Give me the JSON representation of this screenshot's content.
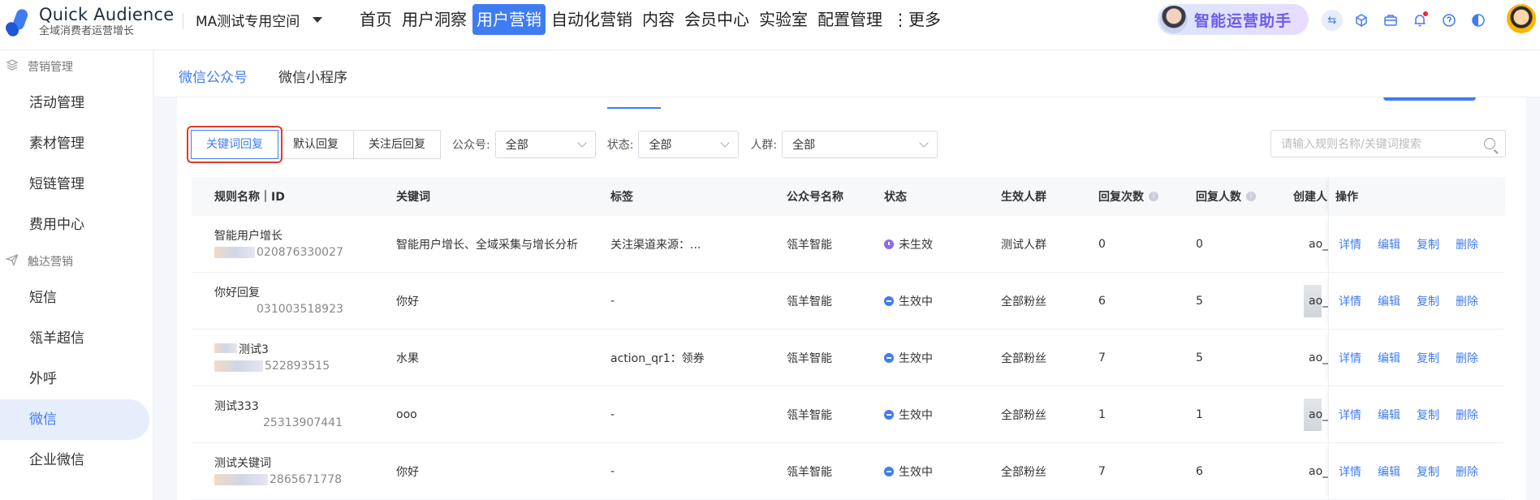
{
  "app": {
    "title": "Quick Audience",
    "subtitle": "全域消费者运营增长",
    "workspace": "MA测试专用空间"
  },
  "nav": {
    "items": [
      "首页",
      "用户洞察",
      "用户营销",
      "自动化营销",
      "内容",
      "会员中心",
      "实验室",
      "配置管理",
      "⋮更多"
    ],
    "active_index": 2
  },
  "assistant": {
    "label": "智能运营助手"
  },
  "header_icons": [
    "swap-icon",
    "cube-icon",
    "briefcase-icon",
    "bell-icon",
    "help-icon",
    "theme-icon"
  ],
  "sidebar": {
    "groups": [
      {
        "label": "营销管理",
        "icon": "layers-icon",
        "items": [
          "活动管理",
          "素材管理",
          "短链管理",
          "费用中心"
        ]
      },
      {
        "label": "触达营销",
        "icon": "send-icon",
        "items": [
          "短信",
          "瓴羊超信",
          "外呼",
          "微信",
          "企业微信"
        ]
      }
    ],
    "active_item": "微信"
  },
  "subtabs": {
    "items": [
      "微信公众号",
      "微信小程序"
    ],
    "active_index": 0
  },
  "filters": {
    "segments": [
      "关键词回复",
      "默认回复",
      "关注后回复"
    ],
    "active_segment": 0,
    "account_label": "公众号:",
    "account_value": "全部",
    "status_label": "状态:",
    "status_value": "全部",
    "crowd_label": "人群:",
    "crowd_value": "全部",
    "search_placeholder": "请输入规则名称/关键词搜索"
  },
  "table": {
    "columns": [
      "规则名称｜ID",
      "关键词",
      "标签",
      "公众号名称",
      "状态",
      "生效人群",
      "回复次数",
      "回复人数",
      "创建人",
      "操作"
    ],
    "rows": [
      {
        "name": "智能用户增长",
        "id_visible": "020876330027",
        "keyword": "智能用户增长、全域采集与增长分析",
        "tag": "关注渠道来源：...",
        "account": "瓴羊智能",
        "status": "未生效",
        "status_type": "pending",
        "crowd": "测试人群",
        "reply_count": "0",
        "reply_users": "0",
        "creator": "ao_"
      },
      {
        "name": "你好回复",
        "id_visible": "031003518923",
        "keyword": "你好",
        "tag": "-",
        "account": "瓴羊智能",
        "status": "生效中",
        "status_type": "active",
        "crowd": "全部粉丝",
        "reply_count": "6",
        "reply_users": "5",
        "creator": "ao_"
      },
      {
        "name": "测试3",
        "id_visible": "522893515",
        "keyword": "水果",
        "tag": "action_qr1：领券",
        "account": "瓴羊智能",
        "status": "生效中",
        "status_type": "active",
        "crowd": "全部粉丝",
        "reply_count": "7",
        "reply_users": "5",
        "creator": "ao_"
      },
      {
        "name": "测试333",
        "id_visible": "25313907441",
        "keyword": "ooo",
        "tag": "-",
        "account": "瓴羊智能",
        "status": "生效中",
        "status_type": "active",
        "crowd": "全部粉丝",
        "reply_count": "1",
        "reply_users": "1",
        "creator": "ao_"
      },
      {
        "name": "测试关键词",
        "id_visible": "2865671778",
        "keyword": "你好",
        "tag": "-",
        "account": "瓴羊智能",
        "status": "生效中",
        "status_type": "active",
        "crowd": "全部粉丝",
        "reply_count": "7",
        "reply_users": "6",
        "creator": "ao_"
      }
    ],
    "actions": [
      "详情",
      "编辑",
      "复制",
      "删除"
    ]
  },
  "colors": {
    "accent": "#3f7cf3",
    "highlight": "#e1392c",
    "pending": "#8c6be8"
  }
}
